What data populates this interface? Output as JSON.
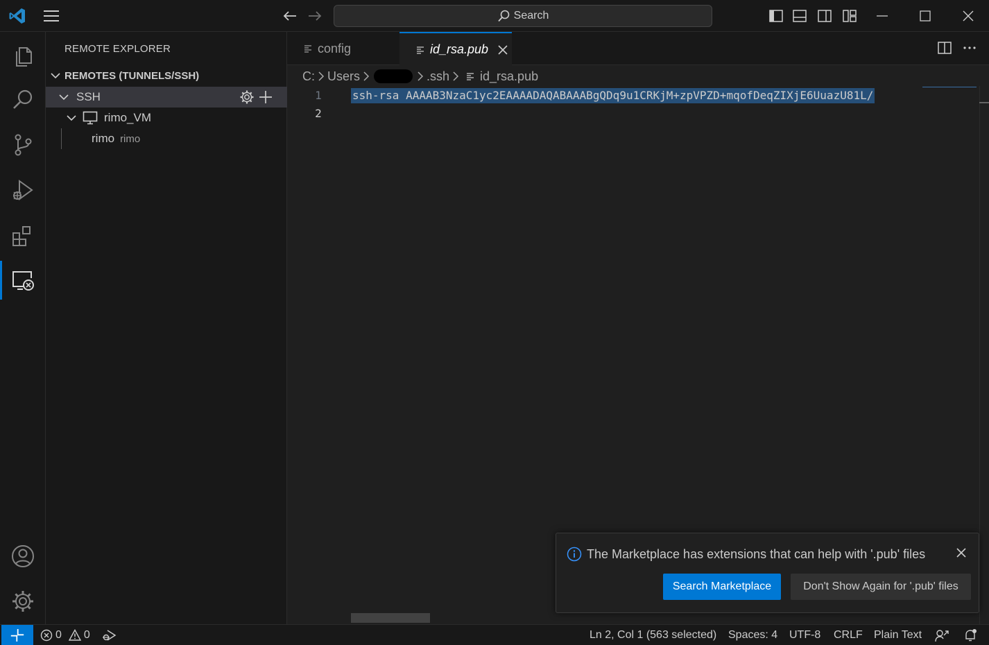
{
  "titlebar": {
    "search_label": "Search",
    "icons": [
      "vscode-logo-icon",
      "menu-icon",
      "back-arrow-icon",
      "forward-arrow-icon",
      "search-icon",
      "toggle-primary-sidebar-icon",
      "toggle-panel-icon",
      "toggle-secondary-sidebar-icon",
      "customize-layout-icon",
      "minimize-icon",
      "maximize-icon",
      "close-icon"
    ]
  },
  "activitybar": {
    "items": [
      "explorer-icon",
      "search-icon",
      "source-control-icon",
      "run-debug-icon",
      "extensions-icon",
      "remote-explorer-icon"
    ],
    "bottom": [
      "accounts-icon",
      "manage-gear-icon"
    ]
  },
  "sidebar": {
    "title": "REMOTE EXPLORER",
    "section": "REMOTES (TUNNELS/SSH)",
    "ssh_label": "SSH",
    "host_label": "rimo_VM",
    "user_label": "rimo",
    "user_desc": "rimo"
  },
  "tabs": [
    {
      "label": "config",
      "active": false
    },
    {
      "label": "id_rsa.pub",
      "active": true
    }
  ],
  "breadcrumb": {
    "drive": "C:",
    "users": "Users",
    "ssh": ".ssh",
    "file": "id_rsa.pub"
  },
  "editor": {
    "lines": [
      "1",
      "2"
    ],
    "line1": "ssh-rsa AAAAB3NzaC1yc2EAAAADAQABAAABgQDq9u1CRKjM+zpVPZD+mqofDeqZIXjE6UuazU81L/"
  },
  "notification": {
    "message": "The Marketplace has extensions that can help with '.pub' files",
    "primary_button": "Search Marketplace",
    "secondary_button": "Don't Show Again for '.pub' files"
  },
  "statusbar": {
    "errors": "0",
    "warnings": "0",
    "position": "Ln 2, Col 1 (563 selected)",
    "spaces": "Spaces: 4",
    "encoding": "UTF-8",
    "eol": "CRLF",
    "language": "Plain Text"
  },
  "colors": {
    "accent": "#0078d4",
    "selection": "#264f78",
    "background": "#1f1f1f"
  }
}
